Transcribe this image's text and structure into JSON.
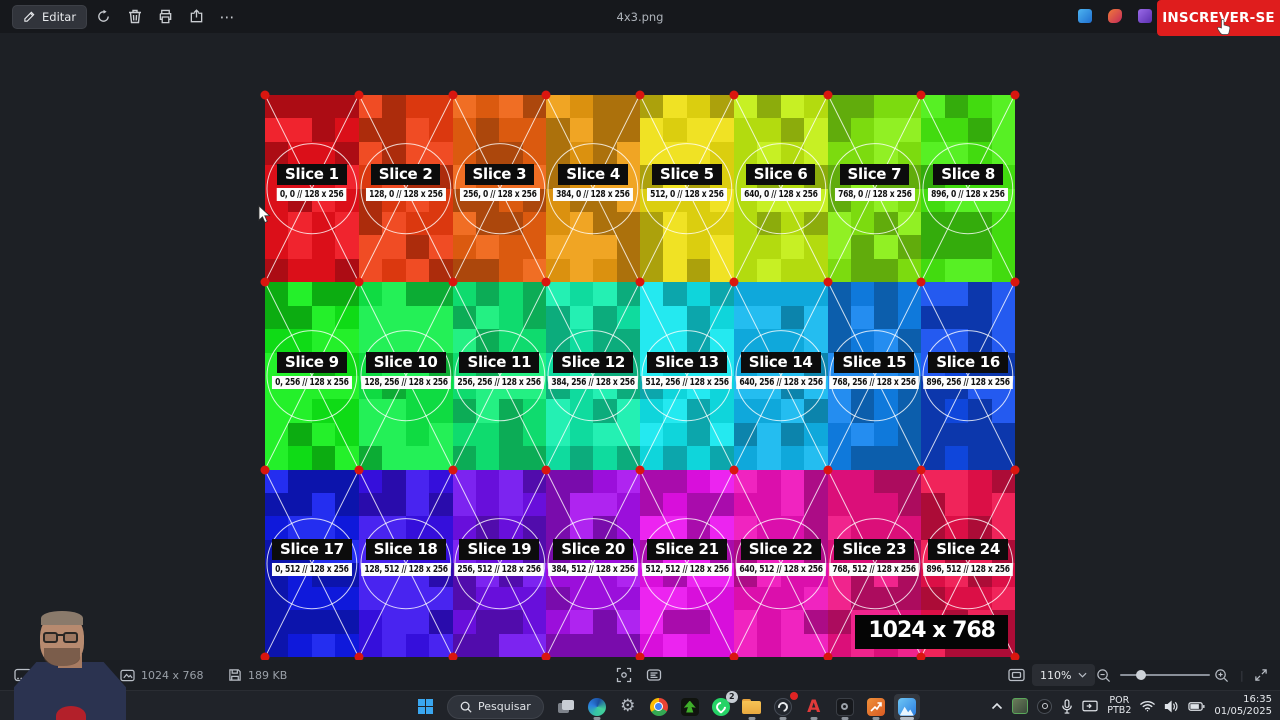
{
  "window": {
    "title": "4x3.png"
  },
  "toolbar": {
    "edit": "Editar",
    "more_glyph": "⋯"
  },
  "promo": {
    "subscribe": "INSCREVER-SE"
  },
  "colors": {
    "subscribe_red": "#df1d1d",
    "handle_red": "#d9160f",
    "sat": 87,
    "lights": [
      36,
      46,
      54
    ]
  },
  "viewer": {
    "size_badge": "1024 x 768",
    "columns": 8,
    "rows": 3,
    "slices": [
      {
        "name": "Slice 1",
        "coords": "0, 0 // 128 x 256",
        "hue": 357
      },
      {
        "name": "Slice 2",
        "coords": "128, 0 // 128 x 256",
        "hue": 12
      },
      {
        "name": "Slice 3",
        "coords": "256, 0 // 128 x 256",
        "hue": 22
      },
      {
        "name": "Slice 4",
        "coords": "384, 0 // 128 x 256",
        "hue": 38
      },
      {
        "name": "Slice 5",
        "coords": "512, 0 // 128 x 256",
        "hue": 56
      },
      {
        "name": "Slice 6",
        "coords": "640, 0 // 128 x 256",
        "hue": 72
      },
      {
        "name": "Slice 7",
        "coords": "768, 0 // 128 x 256",
        "hue": 88
      },
      {
        "name": "Slice 8",
        "coords": "896, 0 // 128 x 256",
        "hue": 105
      },
      {
        "name": "Slice 9",
        "coords": "0, 256 // 128 x 256",
        "hue": 122
      },
      {
        "name": "Slice 10",
        "coords": "128, 256 // 128 x 256",
        "hue": 135
      },
      {
        "name": "Slice 11",
        "coords": "256, 256 // 128 x 256",
        "hue": 148
      },
      {
        "name": "Slice 12",
        "coords": "384, 256 // 128 x 256",
        "hue": 162
      },
      {
        "name": "Slice 13",
        "coords": "512, 256 // 128 x 256",
        "hue": 182
      },
      {
        "name": "Slice 14",
        "coords": "640, 256 // 128 x 256",
        "hue": 195
      },
      {
        "name": "Slice 15",
        "coords": "768, 256 // 128 x 256",
        "hue": 209
      },
      {
        "name": "Slice 16",
        "coords": "896, 256 // 128 x 256",
        "hue": 224
      },
      {
        "name": "Slice 17",
        "coords": "0, 512 // 128 x 256",
        "hue": 237
      },
      {
        "name": "Slice 18",
        "coords": "128, 512 // 128 x 256",
        "hue": 251
      },
      {
        "name": "Slice 19",
        "coords": "256, 512 // 128 x 256",
        "hue": 266
      },
      {
        "name": "Slice 20",
        "coords": "384, 512 // 128 x 256",
        "hue": 281
      },
      {
        "name": "Slice 21",
        "coords": "512, 512 // 128 x 256",
        "hue": 299
      },
      {
        "name": "Slice 22",
        "coords": "640, 512 // 128 x 256",
        "hue": 314
      },
      {
        "name": "Slice 23",
        "coords": "768, 512 // 128 x 256",
        "hue": 329
      },
      {
        "name": "Slice 24",
        "coords": "896, 512 // 128 x 256",
        "hue": 344
      }
    ]
  },
  "statusbar": {
    "dimensions": "1024 x 768",
    "filesize": "189 KB",
    "zoom": "110%"
  },
  "taskbar": {
    "search": "Pesquisar",
    "lang_line1": "POR",
    "lang_line2": "PTB2",
    "time": "16:35",
    "date": "01/05/2025",
    "badge_whatsapp": "2",
    "letter_a": "A"
  },
  "icons": {
    "gear": "⚙"
  }
}
